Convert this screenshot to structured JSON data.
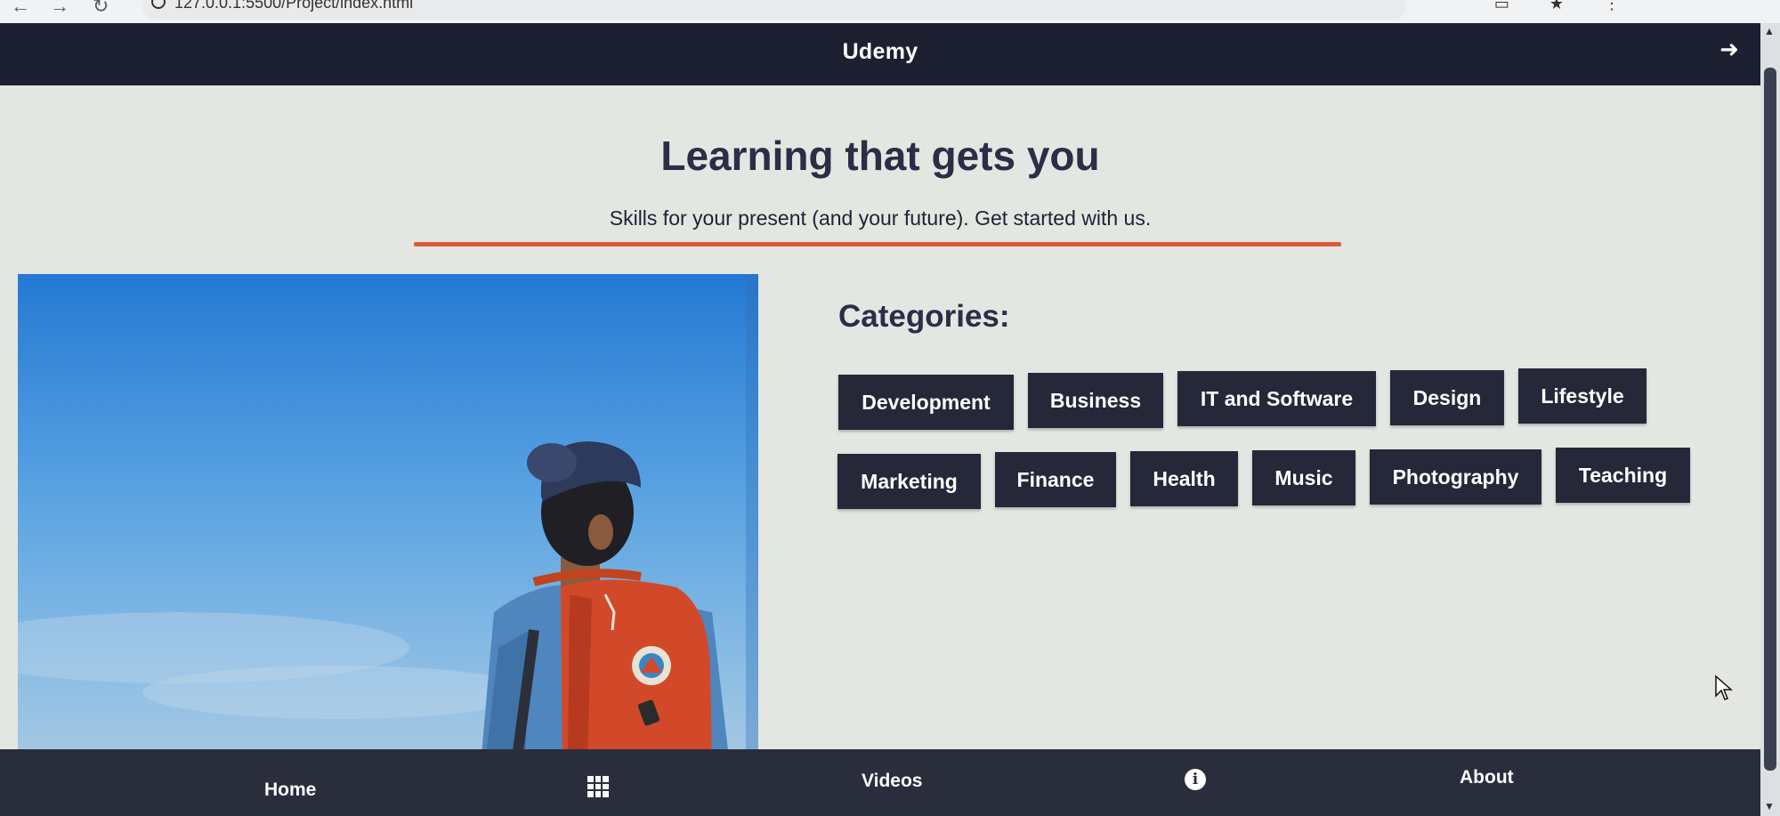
{
  "browser": {
    "url": "127.0.0.1:5500/Project/index.html"
  },
  "topbar": {
    "brand": "Udemy",
    "logout_icon": "arrow-right-icon"
  },
  "hero": {
    "title": "Learning that gets you",
    "subtitle": "Skills for your present (and your future). Get started with us."
  },
  "categories": {
    "title": "Categories:",
    "row1": [
      "Development",
      "Business",
      "IT and Software",
      "Design",
      "Lifestyle"
    ],
    "row2": [
      "Marketing",
      "Finance",
      "Health",
      "Music",
      "Photography",
      "Teaching"
    ]
  },
  "bottomnav": {
    "home": "Home",
    "videos": "Videos",
    "about": "About",
    "videos_icon": "grid-icon",
    "about_icon": "info-icon"
  },
  "colors": {
    "bar": "#1d2030",
    "button": "#252838",
    "accent_rule": "#e05a3c",
    "background": "#e4e6e2"
  }
}
